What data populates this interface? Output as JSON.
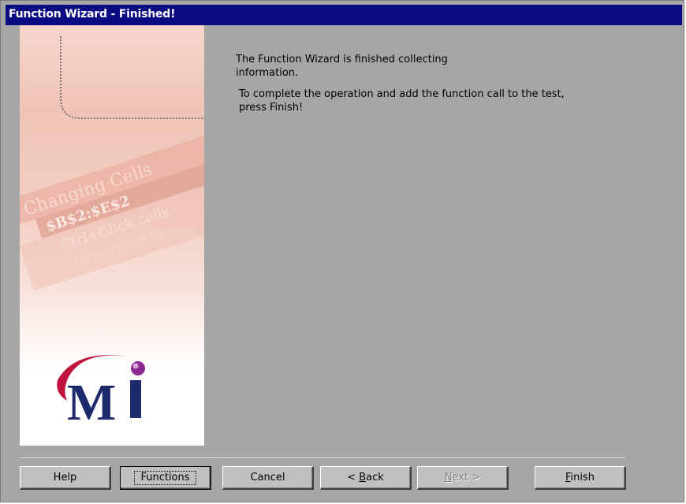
{
  "window": {
    "title": "Function Wizard - Finished!"
  },
  "side_image": {
    "logo": "mercury-logo",
    "watermark_text": [
      "Changing Cells",
      "$B$2:$E$2",
      "Ctrl+Click cells",
      "non-adjacent"
    ]
  },
  "content": {
    "message_1": "The Function Wizard is finished collecting information.",
    "message_2": "To complete the operation and add the function call to the test, press Finish!"
  },
  "buttons": {
    "help": "Help",
    "functions": "Functions",
    "cancel": "Cancel",
    "back_prefix": "< ",
    "back_mnemonic": "B",
    "back_rest": "ack",
    "next_mnemonic": "N",
    "next_rest": "ext >",
    "finish_mnemonic": "F",
    "finish_rest": "inish"
  },
  "colors": {
    "title_bar": "#0a0a82",
    "dialog_bg": "#a6a6a6",
    "button_face": "#c0c0c0"
  }
}
